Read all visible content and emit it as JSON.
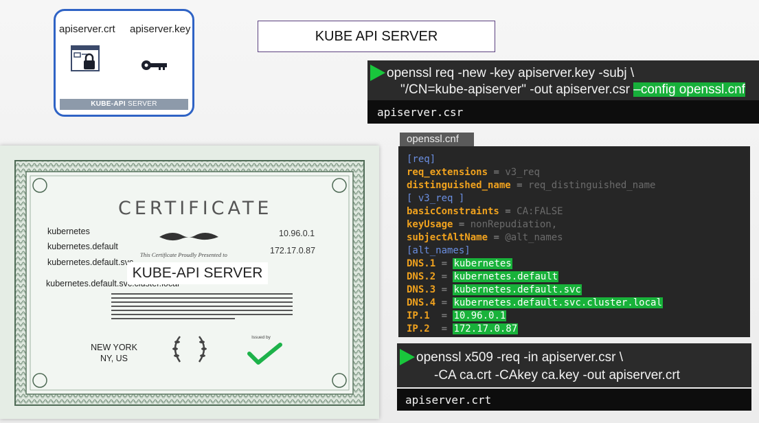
{
  "key_card": {
    "crt_label": "apiserver.crt",
    "key_label": "apiserver.key",
    "strip_bold": "KUBE-API",
    "strip_rest": " SERVER"
  },
  "title": "KUBE API SERVER",
  "csr_command": {
    "line1": "openssl req -new -key apiserver.key -subj \\",
    "line2_plain": "\"/CN=kube-apiserver\" -out apiserver.csr ",
    "line2_highlight": "–config openssl.cnf",
    "output": "apiserver.csr"
  },
  "openssl_cnf": {
    "tab": "openssl.cnf",
    "lines": [
      {
        "sec": "[req]"
      },
      {
        "k": "req_extensions",
        "v": "v3_req"
      },
      {
        "k2": "distinguished_name",
        "v": "req_distinguished_name"
      },
      {
        "sec": "[ v3_req ]"
      },
      {
        "k": "basicConstraints",
        "v": "CA:FALSE"
      },
      {
        "k": "keyUsage",
        "v": "nonRepudiation,"
      },
      {
        "k": "subjectAltName",
        "v": "@alt_names"
      },
      {
        "sec": "[alt_names]"
      },
      {
        "k": "DNS.1",
        "dv": "kubernetes"
      },
      {
        "k": "DNS.2",
        "dv": "kubernetes.default"
      },
      {
        "k": "DNS.3",
        "dv": "kubernetes.default.svc"
      },
      {
        "k": "DNS.4",
        "dv": "kubernetes.default.svc.cluster.local"
      },
      {
        "k": "IP.1 ",
        "dv": "10.96.0.1"
      },
      {
        "k": "IP.2 ",
        "dv": "172.17.0.87"
      }
    ]
  },
  "sign_command": {
    "line1": "openssl x509 -req -in apiserver.csr \\",
    "line2": "-CA ca.crt -CAkey ca.key -out apiserver.crt",
    "output": "apiserver.crt"
  },
  "certificate": {
    "heading": "CERTIFICATE",
    "sans": [
      "kubernetes",
      "kubernetes.default",
      "kubernetes.default.svc",
      "kubernetes.default.svc.cluster.local"
    ],
    "ips": [
      "10.96.0.1",
      "172.17.0.87"
    ],
    "presented": "This Certificate Proudly Presented to",
    "name": "KUBE-API SERVER",
    "location_line1": "NEW YORK",
    "location_line2": "NY, US",
    "issued_by": "Issued by"
  },
  "colors": {
    "highlight_green": "#17b03a",
    "card_border": "#2f63c5",
    "key_orange": "#f0a21e"
  }
}
